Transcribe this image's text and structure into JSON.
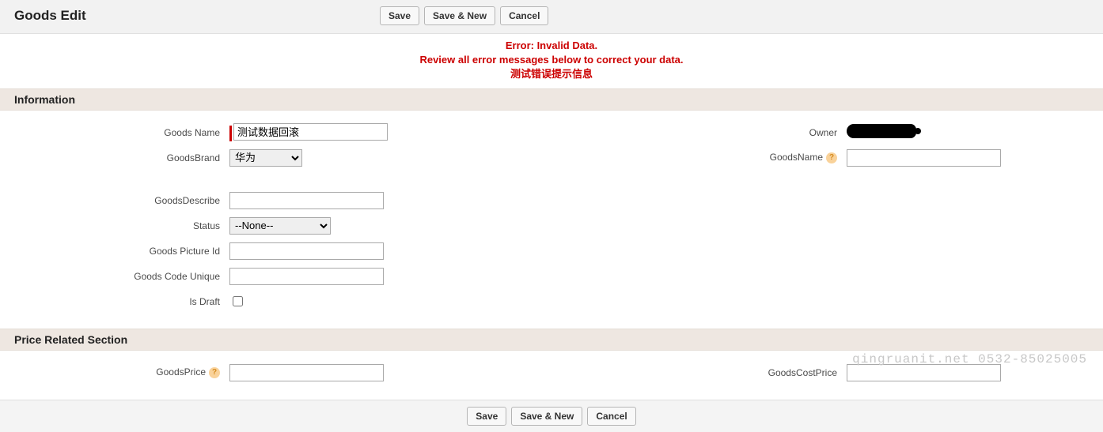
{
  "page": {
    "title": "Goods Edit"
  },
  "buttons": {
    "save": "Save",
    "save_new": "Save & New",
    "cancel": "Cancel"
  },
  "error": {
    "line1": "Error: Invalid Data.",
    "line2": "Review all error messages below to correct your data.",
    "line3": "测试错误提示信息"
  },
  "sections": {
    "information": "Information",
    "price": "Price Related Section"
  },
  "fields": {
    "goods_name": {
      "label": "Goods Name",
      "value": "测试数据回滚"
    },
    "goods_brand": {
      "label": "GoodsBrand",
      "value": "华为",
      "options": [
        "华为"
      ]
    },
    "owner": {
      "label": "Owner"
    },
    "goods_name2": {
      "label": "GoodsName",
      "value": ""
    },
    "goods_describe": {
      "label": "GoodsDescribe",
      "value": ""
    },
    "status": {
      "label": "Status",
      "value": "--None--",
      "options": [
        "--None--"
      ]
    },
    "goods_picture_id": {
      "label": "Goods Picture Id",
      "value": ""
    },
    "goods_code_unique": {
      "label": "Goods Code Unique",
      "value": ""
    },
    "is_draft": {
      "label": "Is Draft",
      "checked": false
    },
    "goods_price": {
      "label": "GoodsPrice",
      "value": ""
    },
    "goods_cost_price": {
      "label": "GoodsCostPrice",
      "value": ""
    }
  },
  "watermark": "qingruanit.net 0532-85025005"
}
